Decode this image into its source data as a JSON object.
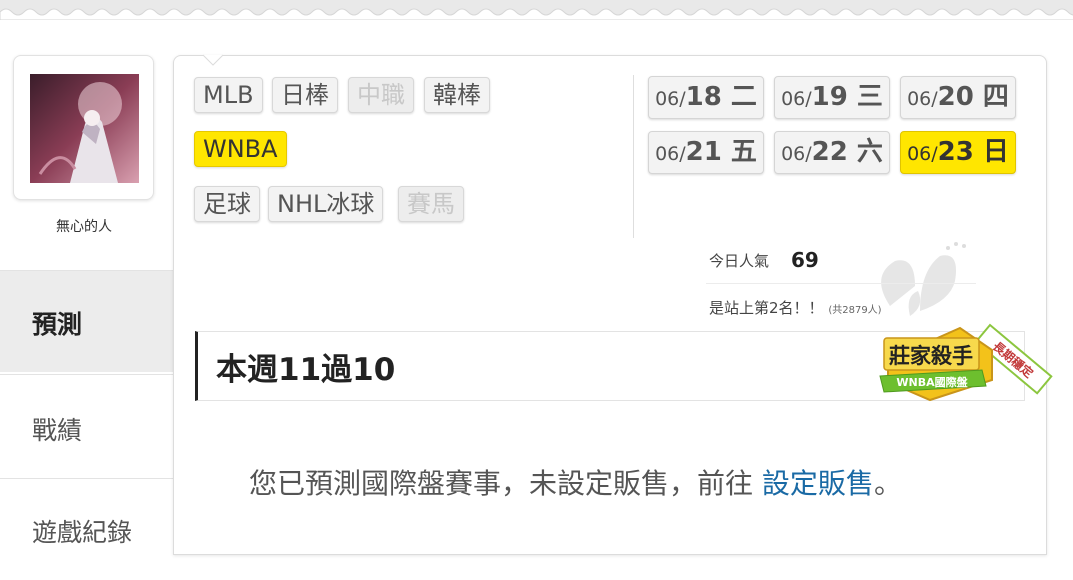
{
  "user": {
    "name": "無心的人",
    "avatar": "avatar-image"
  },
  "sidebar": {
    "items": [
      {
        "label": "預測",
        "active": true
      },
      {
        "label": "戰績",
        "active": false
      },
      {
        "label": "遊戲紀錄",
        "active": false
      }
    ]
  },
  "sports": {
    "row1": [
      {
        "label": "MLB",
        "state": "normal"
      },
      {
        "label": "日棒",
        "state": "normal"
      },
      {
        "label": "中職",
        "state": "disabled"
      },
      {
        "label": "韓棒",
        "state": "normal"
      }
    ],
    "row2": [
      {
        "label": "WNBA",
        "state": "active"
      }
    ],
    "row3": [
      {
        "label": "足球",
        "state": "normal"
      },
      {
        "label": "NHL冰球",
        "state": "normal"
      },
      {
        "label": "賽馬",
        "state": "disabled"
      }
    ]
  },
  "dates": [
    {
      "md": "06/",
      "d": "18",
      "wd": "二",
      "active": false
    },
    {
      "md": "06/",
      "d": "19",
      "wd": "三",
      "active": false
    },
    {
      "md": "06/",
      "d": "20",
      "wd": "四",
      "active": false
    },
    {
      "md": "06/",
      "d": "21",
      "wd": "五",
      "active": false
    },
    {
      "md": "06/",
      "d": "22",
      "wd": "六",
      "active": false
    },
    {
      "md": "06/",
      "d": "23",
      "wd": "日",
      "active": true
    }
  ],
  "stats": {
    "popularity_label": "今日人氣",
    "popularity_value": "69",
    "rank_text": "是站上第2名！！",
    "rank_total": "(共2879人)"
  },
  "week": {
    "title": "本週11過10"
  },
  "badge": {
    "title": "莊家殺手",
    "subtitle": "WNBA國際盤",
    "ribbon": "長期穩定"
  },
  "notice": {
    "text": "您已預測國際盤賽事，未設定販售，前往",
    "link": "設定販售",
    "end": "。"
  },
  "colors": {
    "active_yellow": "#ffe600",
    "link_blue": "#1a6aa5",
    "badge_gold": "#f3c21a",
    "badge_green": "#6dbf2e"
  }
}
